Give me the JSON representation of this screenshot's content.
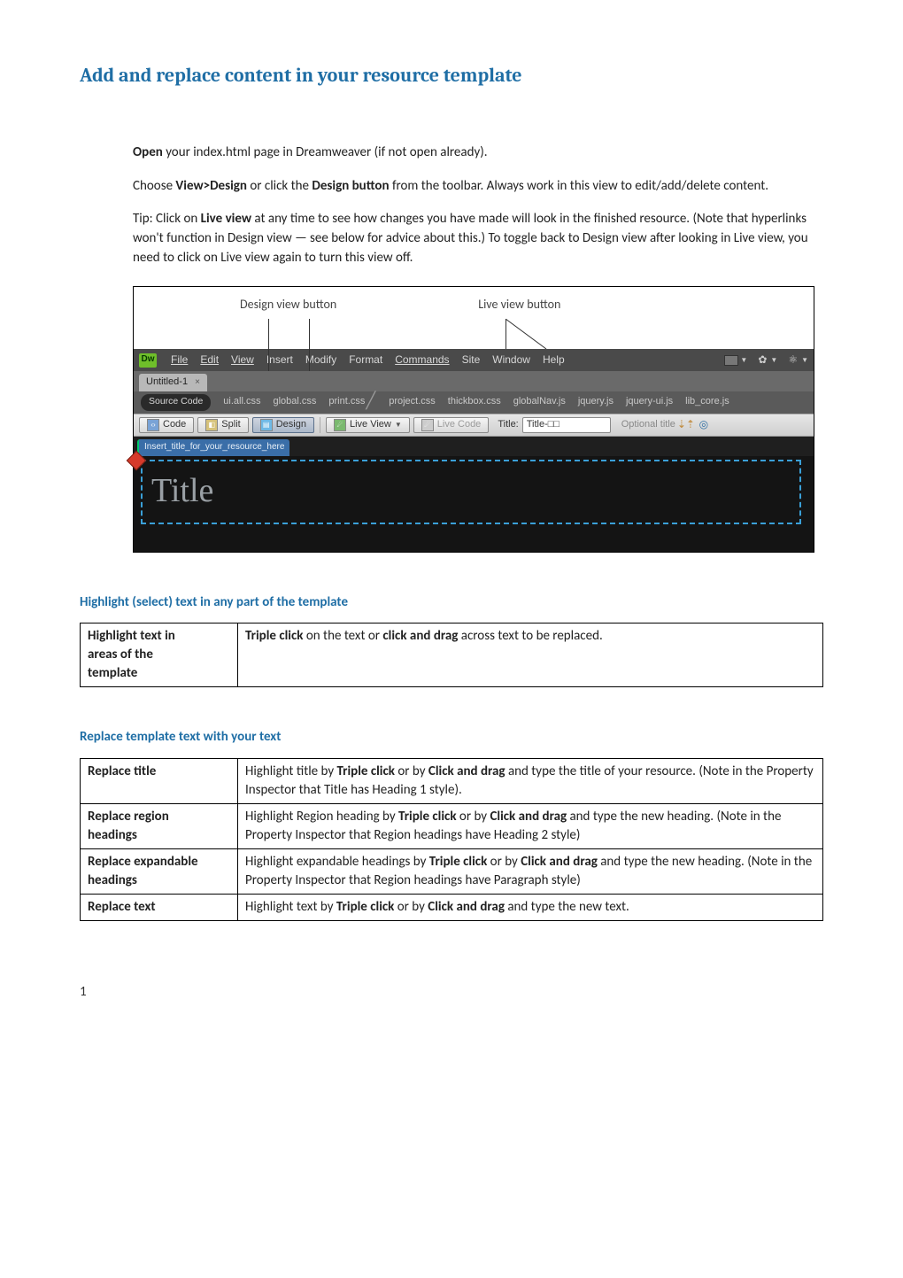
{
  "doc": {
    "title": "Add and replace content in your resource template",
    "intro": {
      "p1a": "Open",
      "p1b": " your index.html page in Dreamweaver (if not open already).",
      "p2a": "Choose ",
      "p2b": "View>Design",
      "p2c": " or click the ",
      "p2d": "Design button",
      "p2e": " from the toolbar. Always work in this view to edit/add/delete content.",
      "p3a": "Tip: Click on ",
      "p3b": "Live view",
      "p3c": " at any time to see how changes you have made will look in the finished resource. (Note that hyperlinks won't function in Design view — see below for advice about this.) To toggle back to Design view after looking in Live view, you need to click on Live view again to turn this view off."
    }
  },
  "shot": {
    "labels": {
      "design": "Design view button",
      "live": "Live view button"
    },
    "dw": "Dw",
    "menu": {
      "file": "File",
      "edit": "Edit",
      "view": "View",
      "insert": "Insert",
      "modify": "Modify",
      "format": "Format",
      "commands": "Commands",
      "site": "Site",
      "window": "Window",
      "help": "Help"
    },
    "docTab": {
      "name": "Untitled-1",
      "close": "×"
    },
    "files": {
      "source": "Source Code",
      "f1": "ui.all.css",
      "f2": "global.css",
      "f3": "print.css",
      "f4": "project.css",
      "f5": "thickbox.css",
      "f6": "globalNav.js",
      "f7": "jquery.js",
      "f8": "jquery-ui.js",
      "f9": "lib_core.js"
    },
    "toolbar": {
      "code": "Code",
      "split": "Split",
      "design": "Design",
      "liveview": "Live View",
      "livecode": "Live Code",
      "titleLabel": "Title:",
      "titleValue": "Title-□□",
      "optional": "Optional title"
    },
    "region": "Insert_title_for_your_resource_here",
    "titlePlaceholder": "Title"
  },
  "sections": {
    "highlight": {
      "heading": "Highlight (select) text in any part of the template",
      "row1_label_l1": "Highlight text in",
      "row1_label_l2": "areas of the",
      "row1_label_l3": "template",
      "row1_text_a": "Triple click",
      "row1_text_b": " on the text or ",
      "row1_text_c": "click and drag",
      "row1_text_d": " across text to be replaced."
    },
    "replace": {
      "heading": "Replace template text with your text",
      "r1_label": "Replace title",
      "r1_a": "Highlight title by ",
      "r1_b": "Triple click",
      "r1_c": " or by ",
      "r1_d": "Click and drag",
      "r1_e": " and type the title of your resource. (Note in the Property Inspector that Title has Heading 1 style).",
      "r2_label_l1": "Replace region",
      "r2_label_l2": "headings",
      "r2_a": "Highlight Region heading by ",
      "r2_b": "Triple click",
      "r2_c": " or by ",
      "r2_d": "Click and drag",
      "r2_e": " and type the new heading. (Note in the Property Inspector that Region headings have Heading 2 style)",
      "r3_label_l1": "Replace expandable",
      "r3_label_l2": "headings",
      "r3_a": "Highlight expandable headings by ",
      "r3_b": "Triple click",
      "r3_c": " or by ",
      "r3_d": "Click and drag",
      "r3_e": " and type the new heading. (Note in the Property Inspector that Region headings have Paragraph  style)",
      "r4_label": "Replace text",
      "r4_a": "Highlight text by ",
      "r4_b": "Triple click",
      "r4_c": " or by ",
      "r4_d": "Click and drag",
      "r4_e": " and type the new text."
    }
  },
  "page": "1"
}
